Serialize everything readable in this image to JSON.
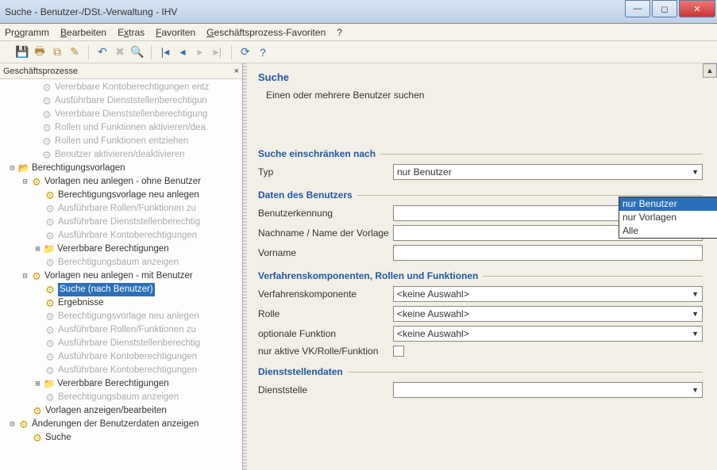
{
  "title": "Suche - Benutzer-/DSt.-Verwaltung - IHV",
  "menu": {
    "programm": "Programm",
    "bearbeiten": "Bearbeiten",
    "extras": "Extras",
    "favoriten": "Favoriten",
    "gpf": "Geschäftsprozess-Favoriten",
    "help": "?"
  },
  "left_header": "Geschäftsprozesse",
  "tree": {
    "n0": "Vererbbare Kontoberechtigungen entz",
    "n1": "Ausführbare Dienststellenberechtigun",
    "n2": "Vererbbare Dienststellenberechtigung",
    "n3": "Rollen und Funktionen aktivieren/dea",
    "n4": "Rollen und Funktionen entziehen",
    "n5": "Benutzer aktivieren/deaktivieren",
    "n6": "Berechtigungsvorlagen",
    "n7": "Vorlagen neu anlegen - ohne Benutzer",
    "n8": "Berechtigungsvorlage neu anlegen",
    "n9": "Ausführbare Rollen/Funktionen zu",
    "n10": "Ausführbare Dienststellenberechtig",
    "n11": "Ausführbare Kontoberechtigungen",
    "n12": "Vererbbare Berechtigungen",
    "n13": "Berechtigungsbaum anzeigen",
    "n14": "Vorlagen neu anlegen - mit Benutzer",
    "n15": "Suche (nach Benutzer)",
    "n16": "Ergebnisse",
    "n17": "Berechtigungsvorlage neu anlegen",
    "n18": "Ausführbare Rollen/Funktionen zu",
    "n19": "Ausführbare Dienststellenberechtig",
    "n20": "Ausführbare Kontoberechtigungen",
    "n21": "Ausführbare Kontoberechtigungen",
    "n22": "Vererbbare Berechtigungen",
    "n23": "Berechtigungsbaum anzeigen",
    "n24": "Vorlagen anzeigen/bearbeiten",
    "n25": "Änderungen der Benutzerdaten anzeigen",
    "n26": "Suche"
  },
  "right": {
    "header": "Suche",
    "intro": "Einen oder mehrere Benutzer suchen",
    "sec1": "Suche einschränken nach",
    "typ_label": "Typ",
    "typ_value": "nur Benutzer",
    "typ_options": {
      "o0": "nur Benutzer",
      "o1": "nur Vorlagen",
      "o2": "Alle"
    },
    "sec2": "Daten des Benutzers",
    "benutzerkennung": "Benutzerkennung",
    "nachname": "Nachname / Name der Vorlage",
    "vorname": "Vorname",
    "sec3": "Verfahrenskomponenten, Rollen und Funktionen",
    "vk_label": "Verfahrenskomponente",
    "rolle_label": "Rolle",
    "optfn_label": "optionale Funktion",
    "nur_aktive": "nur aktive VK/Rolle/Funktion",
    "keine": "<keine Auswahl>",
    "sec4": "Dienststellendaten",
    "dst_label": "Dienststelle"
  }
}
